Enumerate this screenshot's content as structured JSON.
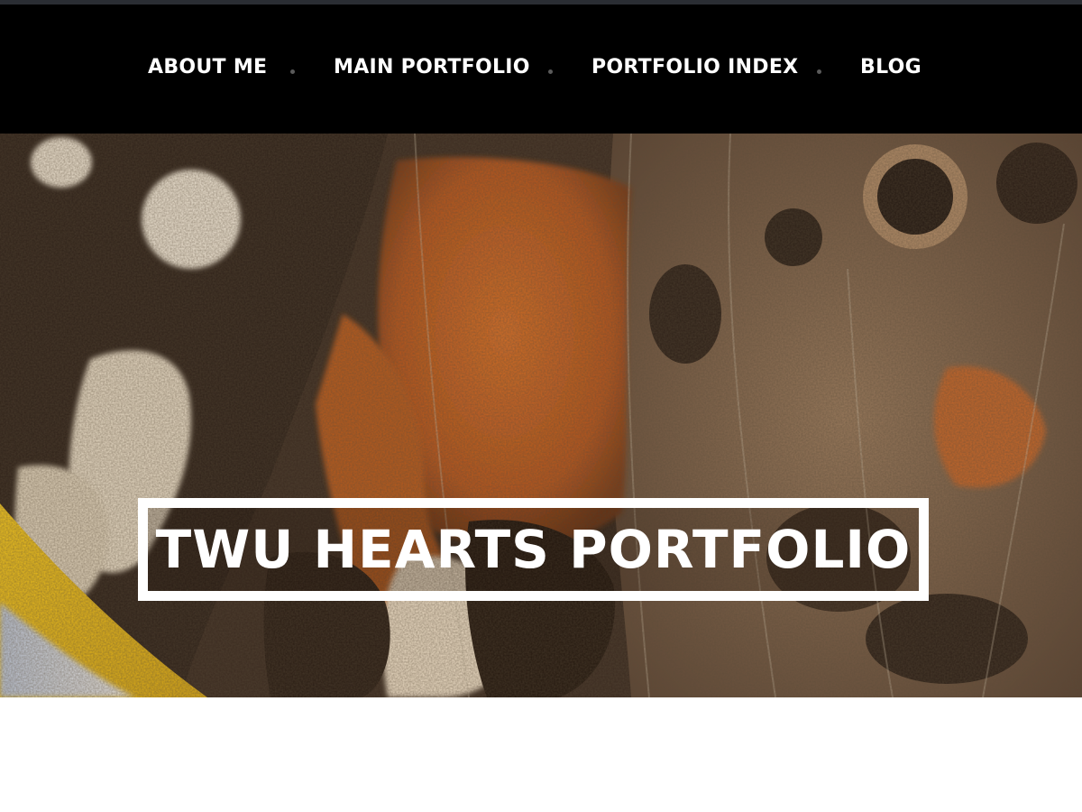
{
  "nav": {
    "items": [
      {
        "label": "ABOUT ME"
      },
      {
        "label": "MAIN PORTFOLIO"
      },
      {
        "label": "PORTFOLIO INDEX"
      },
      {
        "label": "BLOG"
      }
    ]
  },
  "hero": {
    "title": "TWU HEARTS PORTFOLIO"
  },
  "colors": {
    "nav_background": "#000000",
    "nav_text": "#ffffff",
    "separator_dot": "#5a5a5a",
    "title_frame": "#ffffff",
    "wing_orange": "#c8601f",
    "wing_brown": "#3a2a1f",
    "wing_cream": "#efe2cc"
  }
}
